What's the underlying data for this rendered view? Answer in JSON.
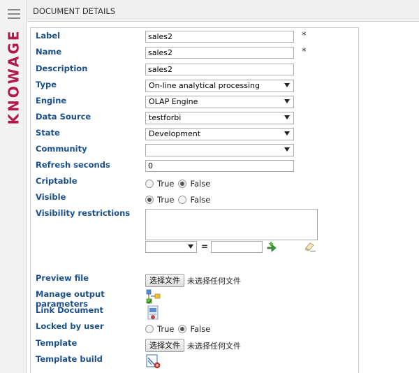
{
  "sidebar": {
    "menu_icon": "hamburger-menu-icon",
    "logo_text": "KNOWAGE",
    "logo_color": "#b0194a"
  },
  "header": {
    "title": "DOCUMENT DETAILS"
  },
  "form": {
    "label": {
      "label": "Label",
      "value": "sales2",
      "required_mark": "*"
    },
    "name": {
      "label": "Name",
      "value": "sales2",
      "required_mark": "*"
    },
    "description": {
      "label": "Description",
      "value": "sales2"
    },
    "type": {
      "label": "Type",
      "value": "On-line analytical processing"
    },
    "engine": {
      "label": "Engine",
      "value": "OLAP Engine"
    },
    "data_source": {
      "label": "Data Source",
      "value": "testforbi"
    },
    "state": {
      "label": "State",
      "value": "Development"
    },
    "community": {
      "label": "Community",
      "value": ""
    },
    "refresh_seconds": {
      "label": "Refresh seconds",
      "value": "0"
    },
    "criptable": {
      "label": "Criptable",
      "true_label": "True",
      "false_label": "False",
      "selected": "False"
    },
    "visible": {
      "label": "Visible",
      "true_label": "True",
      "false_label": "False",
      "selected": "True"
    },
    "visibility_restrictions": {
      "label": "Visibility restrictions",
      "equals": "=",
      "add_icon": "green-arrow-add-icon",
      "clear_icon": "eraser-icon"
    },
    "preview_file": {
      "label": "Preview file",
      "button": "选择文件",
      "status": "未选择任何文件"
    },
    "manage_output_parameters": {
      "label": "Manage output parameters",
      "icon": "output-parameters-icon"
    },
    "link_document": {
      "label": "Link Document",
      "icon": "link-document-icon"
    },
    "locked_by_user": {
      "label": "Locked by user",
      "true_label": "True",
      "false_label": "False",
      "selected": "False"
    },
    "template": {
      "label": "Template",
      "button": "选择文件",
      "status": "未选择任何文件"
    },
    "template_build": {
      "label": "Template build",
      "icon": "template-build-icon"
    }
  },
  "colors": {
    "label_blue": "#1a4f8a",
    "header_bg": "#f0f0f0"
  }
}
